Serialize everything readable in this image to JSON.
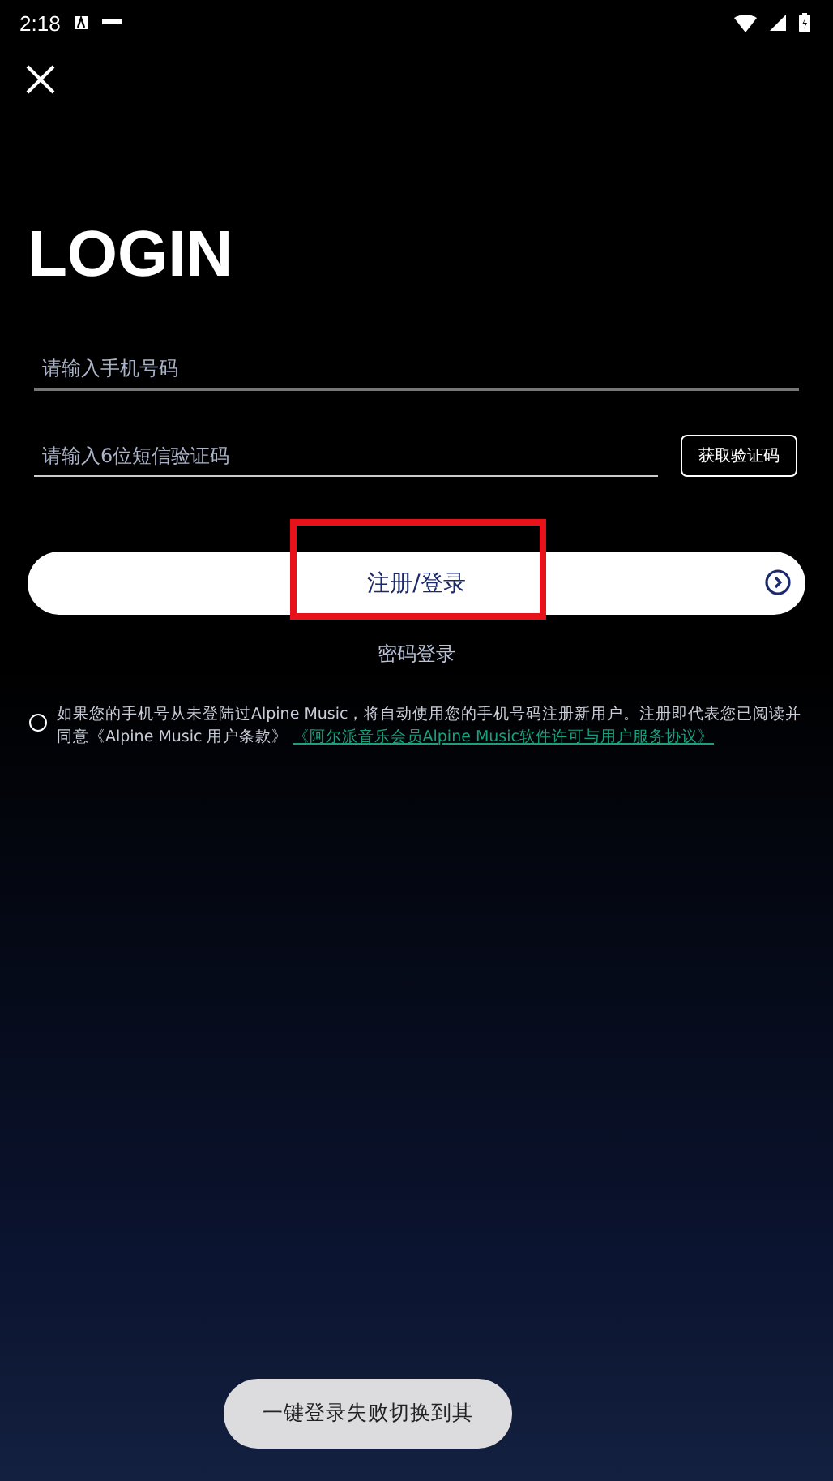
{
  "status_bar": {
    "time": "2:18"
  },
  "title": "LOGIN",
  "phone_field": {
    "placeholder": "请输入手机号码"
  },
  "code_field": {
    "placeholder": "请输入6位短信验证码"
  },
  "get_code_button": "获取验证码",
  "submit_button": "注册/登录",
  "password_login_link": "密码登录",
  "agreement": {
    "checked": false,
    "text": "如果您的手机号从未登陆过Alpine Music，将自动使用您的手机号码注册新用户。注册即代表您已阅读并同意《Alpine Music 用户条款》",
    "link": "《阿尔派音乐会员Alpine Music软件许可与用户服务协议》"
  },
  "toast": "一键登录失败切换到其"
}
